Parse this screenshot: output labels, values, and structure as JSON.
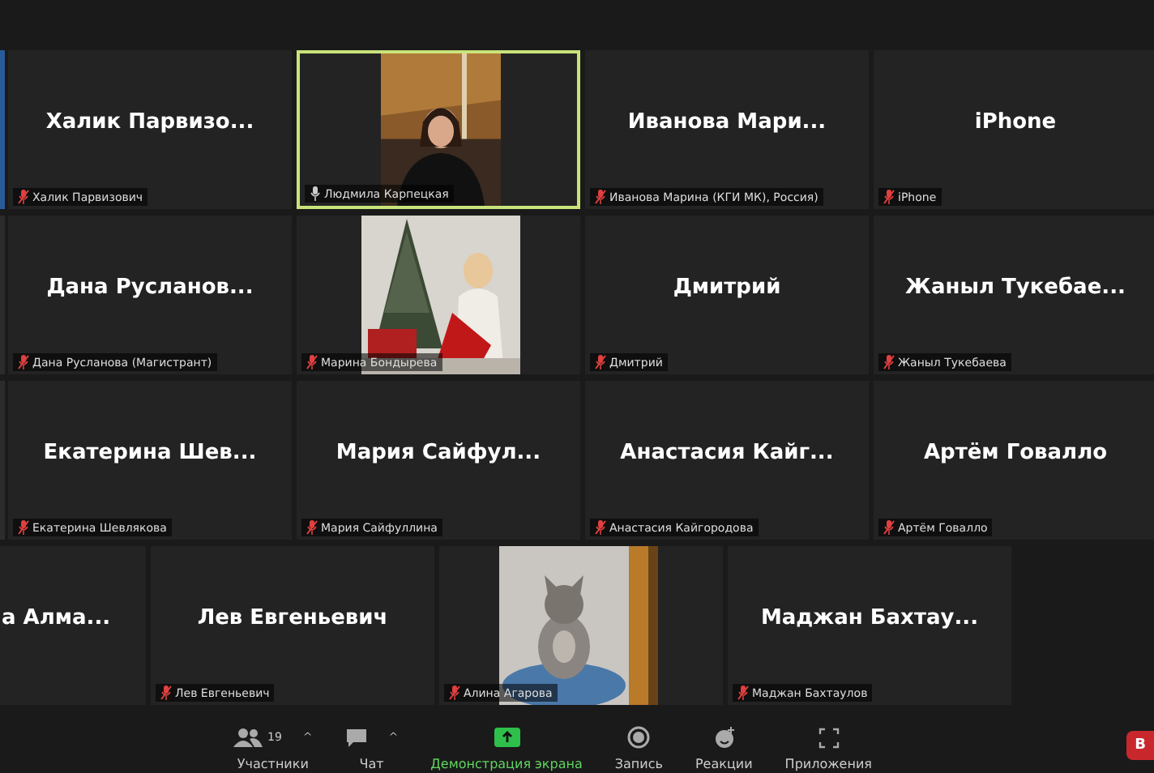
{
  "rows": [
    {
      "tiles": [
        {
          "kind": "avatar",
          "name": "Халик  Парвизо...",
          "label": "Халик Парвизович",
          "muted": true,
          "active_speaker": false,
          "clipped_left": false
        },
        {
          "kind": "person_video",
          "label": "Людмила Карпецкая",
          "muted": false,
          "active_speaker": true,
          "clipped_left": false
        },
        {
          "kind": "avatar",
          "name": "Иванова  Мари...",
          "label": "Иванова Марина (КГИ МК), Россия)",
          "muted": true,
          "active_speaker": false,
          "clipped_left": false
        },
        {
          "kind": "avatar",
          "name": "iPhone",
          "label": "iPhone",
          "muted": true,
          "active_speaker": false,
          "clipped_left": false
        }
      ]
    },
    {
      "tiles": [
        {
          "kind": "avatar",
          "name": "Дана  Русланов...",
          "label": "Дана Русланова (Магистрант)",
          "muted": true,
          "active_speaker": false,
          "clipped_left": false
        },
        {
          "kind": "tree_video",
          "label": "Марина Бондырева",
          "muted": true,
          "active_speaker": false,
          "clipped_left": false
        },
        {
          "kind": "avatar",
          "name": "Дмитрий",
          "label": "Дмитрий",
          "muted": true,
          "active_speaker": false,
          "clipped_left": false
        },
        {
          "kind": "avatar",
          "name": "Жаныл  Тукебае...",
          "label": "Жаныл Тукебаева",
          "muted": true,
          "active_speaker": false,
          "clipped_left": false
        }
      ]
    },
    {
      "tiles": [
        {
          "kind": "avatar",
          "name": "Екатерина  Шев...",
          "label": "Екатерина Шевлякова",
          "muted": true,
          "active_speaker": false,
          "clipped_left": false
        },
        {
          "kind": "avatar",
          "name": "Мария  Сайфул...",
          "label": "Мария Сайфуллина",
          "muted": true,
          "active_speaker": false,
          "clipped_left": false
        },
        {
          "kind": "avatar",
          "name": "Анастасия  Кайг...",
          "label": "Анастасия Кайгородова",
          "muted": true,
          "active_speaker": false,
          "clipped_left": false
        },
        {
          "kind": "avatar",
          "name": "Артём  Говалло",
          "label": "Артём Говалло",
          "muted": true,
          "active_speaker": false,
          "clipped_left": false
        }
      ]
    },
    {
      "tiles": [
        {
          "kind": "avatar",
          "name": "а  Алма...",
          "active_speaker": false,
          "clipped_left": true
        },
        {
          "kind": "avatar",
          "name": "Лев  Евгеньевич",
          "label": "Лев Евгеньевич",
          "muted": true,
          "active_speaker": false,
          "clipped_left": false
        },
        {
          "kind": "cat_video",
          "label": "Алина Агарова",
          "muted": true,
          "active_speaker": false,
          "clipped_left": false
        },
        {
          "kind": "avatar",
          "name": "Маджан  Бахтау...",
          "label": "Маджан Бахтаулов",
          "muted": true,
          "active_speaker": false,
          "clipped_left": false
        }
      ]
    }
  ],
  "toolbar": [
    {
      "kind": "participants",
      "label": "Участники",
      "count": "19",
      "caret": "^"
    },
    {
      "kind": "chat",
      "label": "Чат",
      "caret": "^"
    },
    {
      "kind": "share",
      "label": "Демонстрация экрана"
    },
    {
      "kind": "record",
      "label": "Запись"
    },
    {
      "kind": "reactions",
      "label": "Реакции"
    },
    {
      "kind": "apps",
      "label": "Приложения"
    }
  ],
  "leave_button": "В"
}
